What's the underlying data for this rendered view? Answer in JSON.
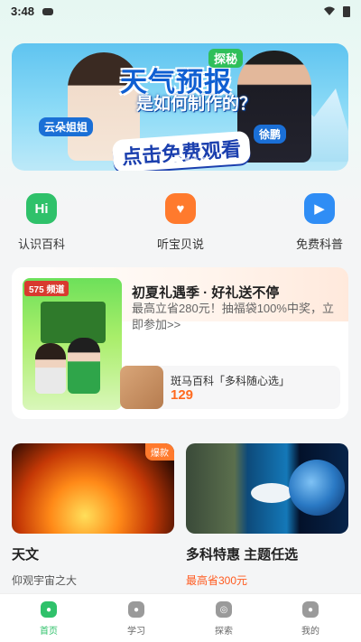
{
  "status_bar": {
    "time": "3:48"
  },
  "banner": {
    "tag": "探秘",
    "title_line1": "天气预报",
    "title_line2": "是如何制作的？",
    "cta": "点击免费观看",
    "host_left": "云朵姐姐",
    "host_right": "徐鹏"
  },
  "quick_entries": [
    {
      "label": "认识百科",
      "icon": "hi-chat-icon",
      "icon_text": "Hi",
      "color": "#2fc16a"
    },
    {
      "label": "听宝贝说",
      "icon": "heart-chat-icon",
      "icon_text": "♥",
      "color": "#ff7a2d"
    },
    {
      "label": "免费科普",
      "icon": "video-play-icon",
      "icon_text": "▶",
      "color": "#2f8df5"
    }
  ],
  "promo": {
    "poster_badge": "575 频道",
    "title": "初夏礼遇季 · 好礼送不停",
    "description": "最高立省280元！抽福袋100%中奖，立即参加>>",
    "product_name": "斑马百科「多科随心选」",
    "product_price": "129"
  },
  "cards": [
    {
      "title": "天文",
      "subtitle": "仰观宇宙之大",
      "badge": "爆款",
      "image": "sun-image"
    },
    {
      "title": "多科特惠 主题任选",
      "subtitle": "最高省300元",
      "image": "dinosaur-whale-earth-image"
    }
  ],
  "bottom_nav": [
    {
      "label": "首页",
      "icon": "home-icon",
      "active": true
    },
    {
      "label": "学习",
      "icon": "study-icon",
      "active": false
    },
    {
      "label": "探索",
      "icon": "explore-icon",
      "active": false
    },
    {
      "label": "我的",
      "icon": "profile-icon",
      "active": false
    }
  ]
}
